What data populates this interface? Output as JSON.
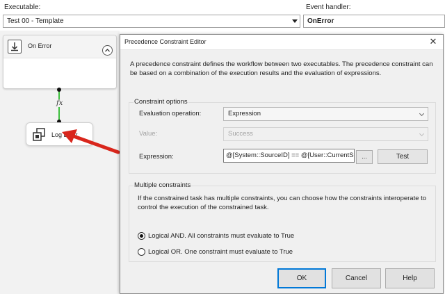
{
  "top": {
    "executable_label": "Executable:",
    "executable_value": "Test 00 - Template",
    "event_handler_label": "Event handler:",
    "event_handler_value": "OnError"
  },
  "canvas": {
    "container_title": "On Error",
    "connector_label": "fx",
    "task_title": "Log Error"
  },
  "dialog": {
    "title": "Precedence Constraint Editor",
    "close_glyph": "✕",
    "description": "A precedence constraint defines the workflow between two executables. The precedence constraint can be based on a combination of the execution results and the evaluation of expressions.",
    "constraint_options": {
      "caption": "Constraint options",
      "evaluation_label": "Evaluation operation:",
      "evaluation_value": "Expression",
      "value_label": "Value:",
      "value_value": "Success",
      "expression_label": "Expression:",
      "expression_value": "@[System::SourceID] ==  @[User::CurrentSource]",
      "ellipsis_label": "...",
      "test_label": "Test"
    },
    "multiple_constraints": {
      "caption": "Multiple constraints",
      "description": "If the constrained task has multiple constraints, you can choose how the constraints interoperate to control the execution of the constrained task.",
      "option_and": "Logical AND. All constraints must evaluate to True",
      "option_or": "Logical OR. One constraint must evaluate to True",
      "selected": "and"
    },
    "buttons": {
      "ok": "OK",
      "cancel": "Cancel",
      "help": "Help"
    }
  },
  "colors": {
    "connector_success": "#3ebf3e",
    "annotation_arrow": "#d9261c",
    "default_button_border": "#0078d7"
  }
}
